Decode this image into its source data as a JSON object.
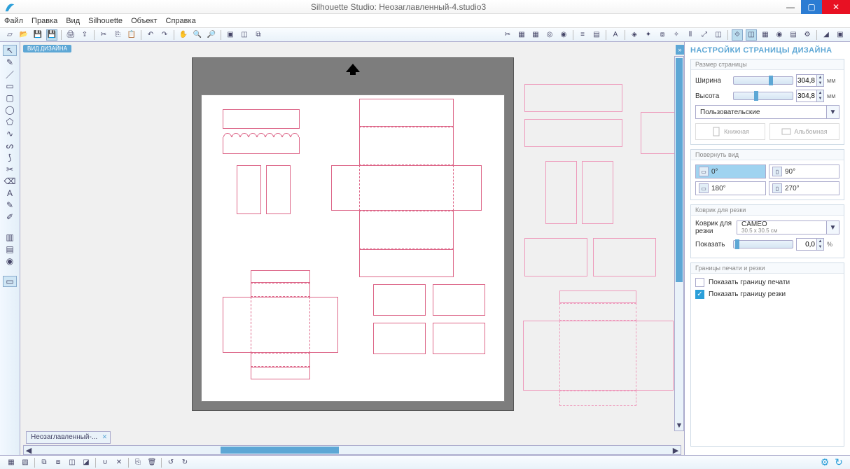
{
  "title": "Silhouette Studio: Неозаглавленный-4.studio3",
  "menu": {
    "file": "Файл",
    "edit": "Правка",
    "view": "Вид",
    "silhouette": "Silhouette",
    "object": "Объект",
    "help": "Справка"
  },
  "design_tag": "ВИД ДИЗАЙНА",
  "doc_tab": "Неозаглавленный-...",
  "panel": {
    "title": "НАСТРОЙКИ СТРАНИЦЫ ДИЗАЙНА",
    "page_size_hdr": "Размер страницы",
    "width_label": "Ширина",
    "height_label": "Высота",
    "width_value": "304,8",
    "height_value": "304,8",
    "unit": "мм",
    "preset": "Пользовательские",
    "orient_portrait": "Книжная",
    "orient_landscape": "Альбомная",
    "rotate_hdr": "Повернуть вид",
    "rot0": "0°",
    "rot90": "90°",
    "rot180": "180°",
    "rot270": "270°",
    "mat_hdr": "Коврик для резки",
    "mat_label": "Коврик для резки",
    "mat_value": "CAMEO",
    "mat_sub": "30.5 x 30.5 см",
    "show_label": "Показать",
    "show_value": "0,0",
    "show_unit": "%",
    "borders_hdr": "Границы печати и резки",
    "show_print_border": "Показать границу печати",
    "show_cut_border": "Показать границу резки"
  }
}
